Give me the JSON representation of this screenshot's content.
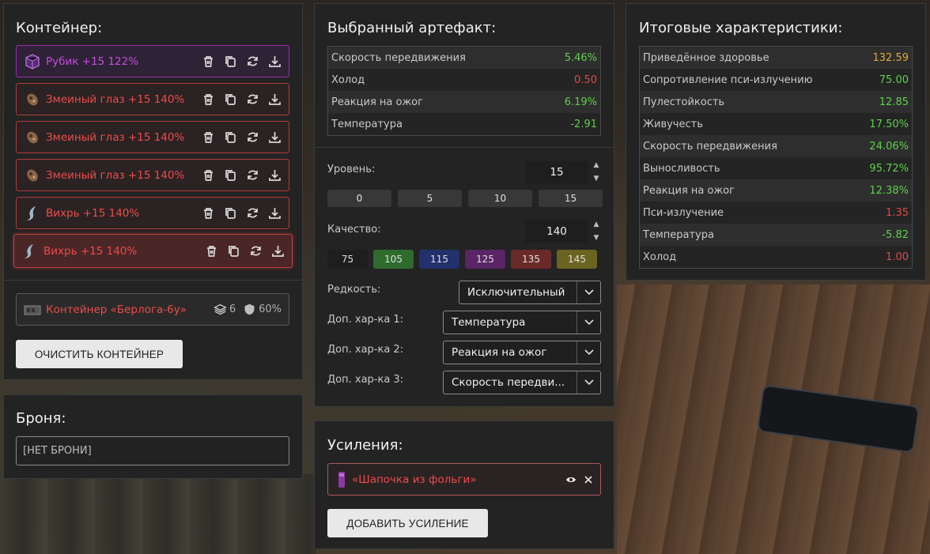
{
  "container": {
    "title": "Контейнер:",
    "artifacts": [
      {
        "name": "Рубик +15 122%",
        "style": "purple",
        "icon": "rubik-cube-icon"
      },
      {
        "name": "Змеиный глаз +15 140%",
        "style": "red",
        "icon": "snake-eye-icon"
      },
      {
        "name": "Змеиный глаз +15 140%",
        "style": "red",
        "icon": "snake-eye-icon"
      },
      {
        "name": "Змеиный глаз +15 140%",
        "style": "red",
        "icon": "snake-eye-icon"
      },
      {
        "name": "Вихрь +15 140%",
        "style": "red",
        "icon": "whirl-icon"
      },
      {
        "name": "Вихрь +15 140%",
        "style": "selected",
        "icon": "whirl-icon"
      }
    ],
    "item": {
      "name": "Контейнер «Берлога-6у»",
      "slots": "6",
      "protection": "60%"
    },
    "clear_label": "ОЧИСТИТЬ КОНТЕЙНЕР"
  },
  "armor": {
    "title": "Броня:",
    "value": "[НЕТ БРОНИ]"
  },
  "artifact": {
    "title": "Выбранный артефакт:",
    "stats": [
      {
        "label": "Скорость передвижения",
        "value": "5.46%",
        "color": "green"
      },
      {
        "label": "Холод",
        "value": "0.50",
        "color": "red"
      },
      {
        "label": "Реакция на ожог",
        "value": "6.19%",
        "color": "green"
      },
      {
        "label": "Температура",
        "value": "-2.91",
        "color": "green"
      }
    ],
    "level_label": "Уровень:",
    "level_value": "15",
    "level_presets": [
      "0",
      "5",
      "10",
      "15"
    ],
    "quality_label": "Качество:",
    "quality_value": "140",
    "quality_presets": [
      {
        "label": "75",
        "color": "#1e1e1e"
      },
      {
        "label": "105",
        "color": "#2f6b2f"
      },
      {
        "label": "115",
        "color": "#23306b"
      },
      {
        "label": "125",
        "color": "#5a2466"
      },
      {
        "label": "135",
        "color": "#6b2a2a"
      },
      {
        "label": "145",
        "color": "#6b6320"
      }
    ],
    "rarity_label": "Редкость:",
    "rarity_value": "Исключительный",
    "extra1_label": "Доп. хар-ка 1:",
    "extra1_value": "Температура",
    "extra2_label": "Доп. хар-ка 2:",
    "extra2_value": "Реакция на ожог",
    "extra3_label": "Доп. хар-ка 3:",
    "extra3_value": "Скорость передви..."
  },
  "boosts": {
    "title": "Усиления:",
    "item": "«Шапочка из фольги»",
    "add_label": "ДОБАВИТЬ УСИЛЕНИЕ"
  },
  "totals": {
    "title": "Итоговые характеристики:",
    "stats": [
      {
        "label": "Приведённое здоровье",
        "value": "132.59",
        "color": "gold"
      },
      {
        "label": "Сопротивление пси-излучению",
        "value": "75.00",
        "color": "green"
      },
      {
        "label": "Пулестойкость",
        "value": "12.85",
        "color": "green"
      },
      {
        "label": "Живучесть",
        "value": "17.50%",
        "color": "green"
      },
      {
        "label": "Скорость передвижения",
        "value": "24.06%",
        "color": "green"
      },
      {
        "label": "Выносливость",
        "value": "95.72%",
        "color": "green"
      },
      {
        "label": "Реакция на ожог",
        "value": "12.38%",
        "color": "green"
      },
      {
        "label": "Пси-излучение",
        "value": "1.35",
        "color": "red"
      },
      {
        "label": "Температура",
        "value": "-5.82",
        "color": "green"
      },
      {
        "label": "Холод",
        "value": "1.00",
        "color": "red"
      }
    ]
  }
}
